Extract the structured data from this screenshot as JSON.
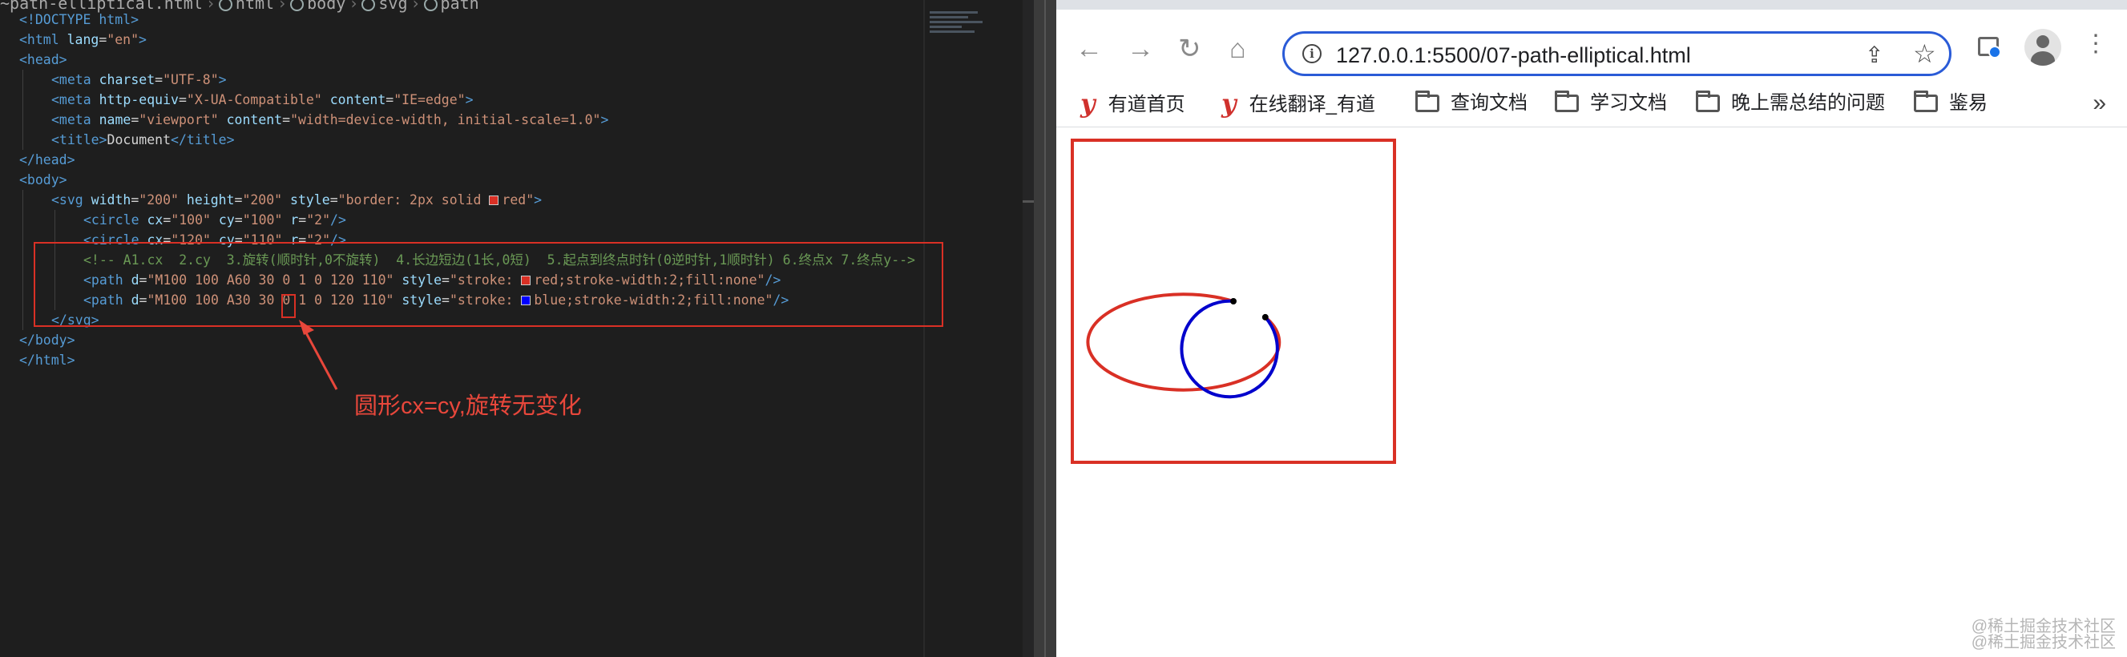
{
  "editor": {
    "breadcrumb": [
      "~path-elliptical.html",
      "html",
      "body",
      "svg",
      "path"
    ],
    "lines": [
      [
        {
          "c": "tag",
          "t": "<!DOCTYPE html>"
        }
      ],
      [
        {
          "c": "tag",
          "t": "<html "
        },
        {
          "c": "attr",
          "t": "lang"
        },
        {
          "c": "txt",
          "t": "="
        },
        {
          "c": "str",
          "t": "\"en\""
        },
        {
          "c": "tag",
          "t": ">"
        }
      ],
      [
        {
          "c": "tag",
          "t": "<head>"
        }
      ],
      [
        {
          "c": "tag",
          "t": "<meta "
        },
        {
          "c": "attr",
          "t": "charset"
        },
        {
          "c": "txt",
          "t": "="
        },
        {
          "c": "str",
          "t": "\"UTF-8\""
        },
        {
          "c": "tag",
          "t": ">"
        }
      ],
      [
        {
          "c": "tag",
          "t": "<meta "
        },
        {
          "c": "attr",
          "t": "http-equiv"
        },
        {
          "c": "txt",
          "t": "="
        },
        {
          "c": "str",
          "t": "\"X-UA-Compatible\""
        },
        {
          "c": "txt",
          "t": " "
        },
        {
          "c": "attr",
          "t": "content"
        },
        {
          "c": "txt",
          "t": "="
        },
        {
          "c": "str",
          "t": "\"IE=edge\""
        },
        {
          "c": "tag",
          "t": ">"
        }
      ],
      [
        {
          "c": "tag",
          "t": "<meta "
        },
        {
          "c": "attr",
          "t": "name"
        },
        {
          "c": "txt",
          "t": "="
        },
        {
          "c": "str",
          "t": "\"viewport\""
        },
        {
          "c": "txt",
          "t": " "
        },
        {
          "c": "attr",
          "t": "content"
        },
        {
          "c": "txt",
          "t": "="
        },
        {
          "c": "str",
          "t": "\"width=device-width, initial-scale=1.0\""
        },
        {
          "c": "tag",
          "t": ">"
        }
      ],
      [
        {
          "c": "tag",
          "t": "<title>"
        },
        {
          "c": "txt",
          "t": "Document"
        },
        {
          "c": "tag",
          "t": "</title>"
        }
      ],
      [
        {
          "c": "tag",
          "t": "</head>"
        }
      ],
      [
        {
          "c": "tag",
          "t": "<body>"
        }
      ],
      [
        {
          "c": "tag",
          "t": "<svg "
        },
        {
          "c": "attr",
          "t": "width"
        },
        {
          "c": "txt",
          "t": "="
        },
        {
          "c": "str",
          "t": "\"200\""
        },
        {
          "c": "txt",
          "t": " "
        },
        {
          "c": "attr",
          "t": "height"
        },
        {
          "c": "txt",
          "t": "="
        },
        {
          "c": "str",
          "t": "\"200\""
        },
        {
          "c": "txt",
          "t": " "
        },
        {
          "c": "attr",
          "t": "style"
        },
        {
          "c": "txt",
          "t": "="
        },
        {
          "c": "str",
          "t": "\"border: 2px solid "
        },
        {
          "c": "swatch",
          "t": "#d93025"
        },
        {
          "c": "str",
          "t": "red\""
        },
        {
          "c": "tag",
          "t": ">"
        }
      ],
      [
        {
          "c": "tag",
          "t": "<circle "
        },
        {
          "c": "attr",
          "t": "cx"
        },
        {
          "c": "txt",
          "t": "="
        },
        {
          "c": "str",
          "t": "\"100\""
        },
        {
          "c": "txt",
          "t": " "
        },
        {
          "c": "attr",
          "t": "cy"
        },
        {
          "c": "txt",
          "t": "="
        },
        {
          "c": "str",
          "t": "\"100\""
        },
        {
          "c": "txt",
          "t": " "
        },
        {
          "c": "attr",
          "t": "r"
        },
        {
          "c": "txt",
          "t": "="
        },
        {
          "c": "str",
          "t": "\"2\""
        },
        {
          "c": "tag",
          "t": "/>"
        }
      ],
      [
        {
          "c": "tag",
          "t": "<circle "
        },
        {
          "c": "attr",
          "t": "cx"
        },
        {
          "c": "txt",
          "t": "="
        },
        {
          "c": "str",
          "t": "\"120\""
        },
        {
          "c": "txt",
          "t": " "
        },
        {
          "c": "attr",
          "t": "cy"
        },
        {
          "c": "txt",
          "t": "="
        },
        {
          "c": "str",
          "t": "\"110\""
        },
        {
          "c": "txt",
          "t": " "
        },
        {
          "c": "attr",
          "t": "r"
        },
        {
          "c": "txt",
          "t": "="
        },
        {
          "c": "str",
          "t": "\"2\""
        },
        {
          "c": "tag",
          "t": "/>"
        }
      ],
      [
        {
          "c": "cm",
          "t": "<!-- A1.cx  2.cy  3.旋转(顺时针,0不旋转)  4.长边短边(1长,0短)  5.起点到终点时针(0逆时针,1顺时针) 6.终点x 7.终点y-->"
        }
      ],
      [
        {
          "c": "tag",
          "t": "<path "
        },
        {
          "c": "attr",
          "t": "d"
        },
        {
          "c": "txt",
          "t": "="
        },
        {
          "c": "str",
          "t": "\"M100 100 A60 30 0 1 0 120 110\""
        },
        {
          "c": "txt",
          "t": " "
        },
        {
          "c": "attr",
          "t": "style"
        },
        {
          "c": "txt",
          "t": "="
        },
        {
          "c": "str",
          "t": "\"stroke: "
        },
        {
          "c": "swatch",
          "t": "#d93025"
        },
        {
          "c": "str",
          "t": "red;stroke-width:2;fill:none\""
        },
        {
          "c": "tag",
          "t": "/>"
        }
      ],
      [
        {
          "c": "tag",
          "t": "<path "
        },
        {
          "c": "attr",
          "t": "d"
        },
        {
          "c": "txt",
          "t": "="
        },
        {
          "c": "str",
          "t": "\"M100 100 A30 30 0 1 0 120 110\""
        },
        {
          "c": "txt",
          "t": " "
        },
        {
          "c": "attr",
          "t": "style"
        },
        {
          "c": "txt",
          "t": "="
        },
        {
          "c": "str",
          "t": "\"stroke: "
        },
        {
          "c": "swatch",
          "t": "#0000ff"
        },
        {
          "c": "str",
          "t": "blue;stroke-width:2;fill:none\""
        },
        {
          "c": "tag",
          "t": "/>"
        }
      ],
      [
        {
          "c": "tag",
          "t": "</svg>"
        }
      ],
      [
        {
          "c": "tag",
          "t": "</body>"
        }
      ],
      [
        {
          "c": "tag",
          "t": "</html>"
        }
      ]
    ],
    "indents": [
      0,
      0,
      0,
      1,
      1,
      1,
      1,
      0,
      0,
      1,
      2,
      2,
      2,
      2,
      2,
      1,
      0,
      0
    ],
    "annotation": "圆形cx=cy,旋转无变化"
  },
  "browser": {
    "url": "127.0.0.1:5500/07-path-elliptical.html",
    "bookmarks": [
      {
        "label": "有道首页",
        "icon": "youdao-icon"
      },
      {
        "label": "在线翻译_有道",
        "icon": "youdao-icon"
      },
      {
        "label": "查询文档",
        "icon": "folder-icon"
      },
      {
        "label": "学习文档",
        "icon": "folder-icon"
      },
      {
        "label": "晚上需总结的问题",
        "icon": "folder-icon"
      },
      {
        "label": "鉴易",
        "icon": "folder-icon"
      }
    ],
    "bookmarks_more": "»",
    "watermark_lines": [
      "@稀土掘金技术社区",
      "@稀土掘金技术社区"
    ]
  },
  "colors": {
    "accent_red": "#d93025",
    "blue": "#0000cc",
    "omnibox_border": "#2a5bd7"
  }
}
